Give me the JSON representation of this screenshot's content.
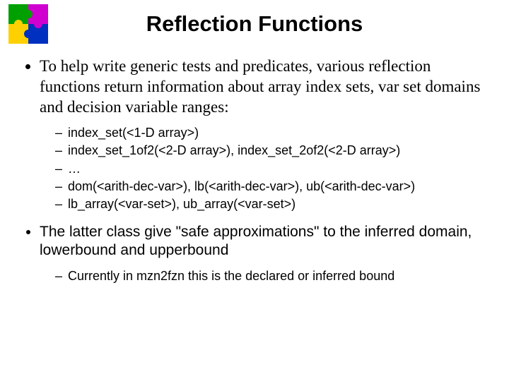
{
  "title": "Reflection Functions",
  "bullets": {
    "b1": "To help write generic tests and predicates, various reflection functions return information about array index sets, var set domains and decision variable ranges:",
    "sub1": [
      "index_set(<1-D array>)",
      "index_set_1of2(<2-D array>), index_set_2of2(<2-D array>)",
      "…",
      "dom(<arith-dec-var>), lb(<arith-dec-var>), ub(<arith-dec-var>)",
      "lb_array(<var-set>), ub_array(<var-set>)"
    ],
    "b2": "The latter class give \"safe approximations\" to the inferred domain, lowerbound and upperbound",
    "sub2": [
      "Currently in mzn2fzn this is the declared or inferred bound"
    ]
  }
}
